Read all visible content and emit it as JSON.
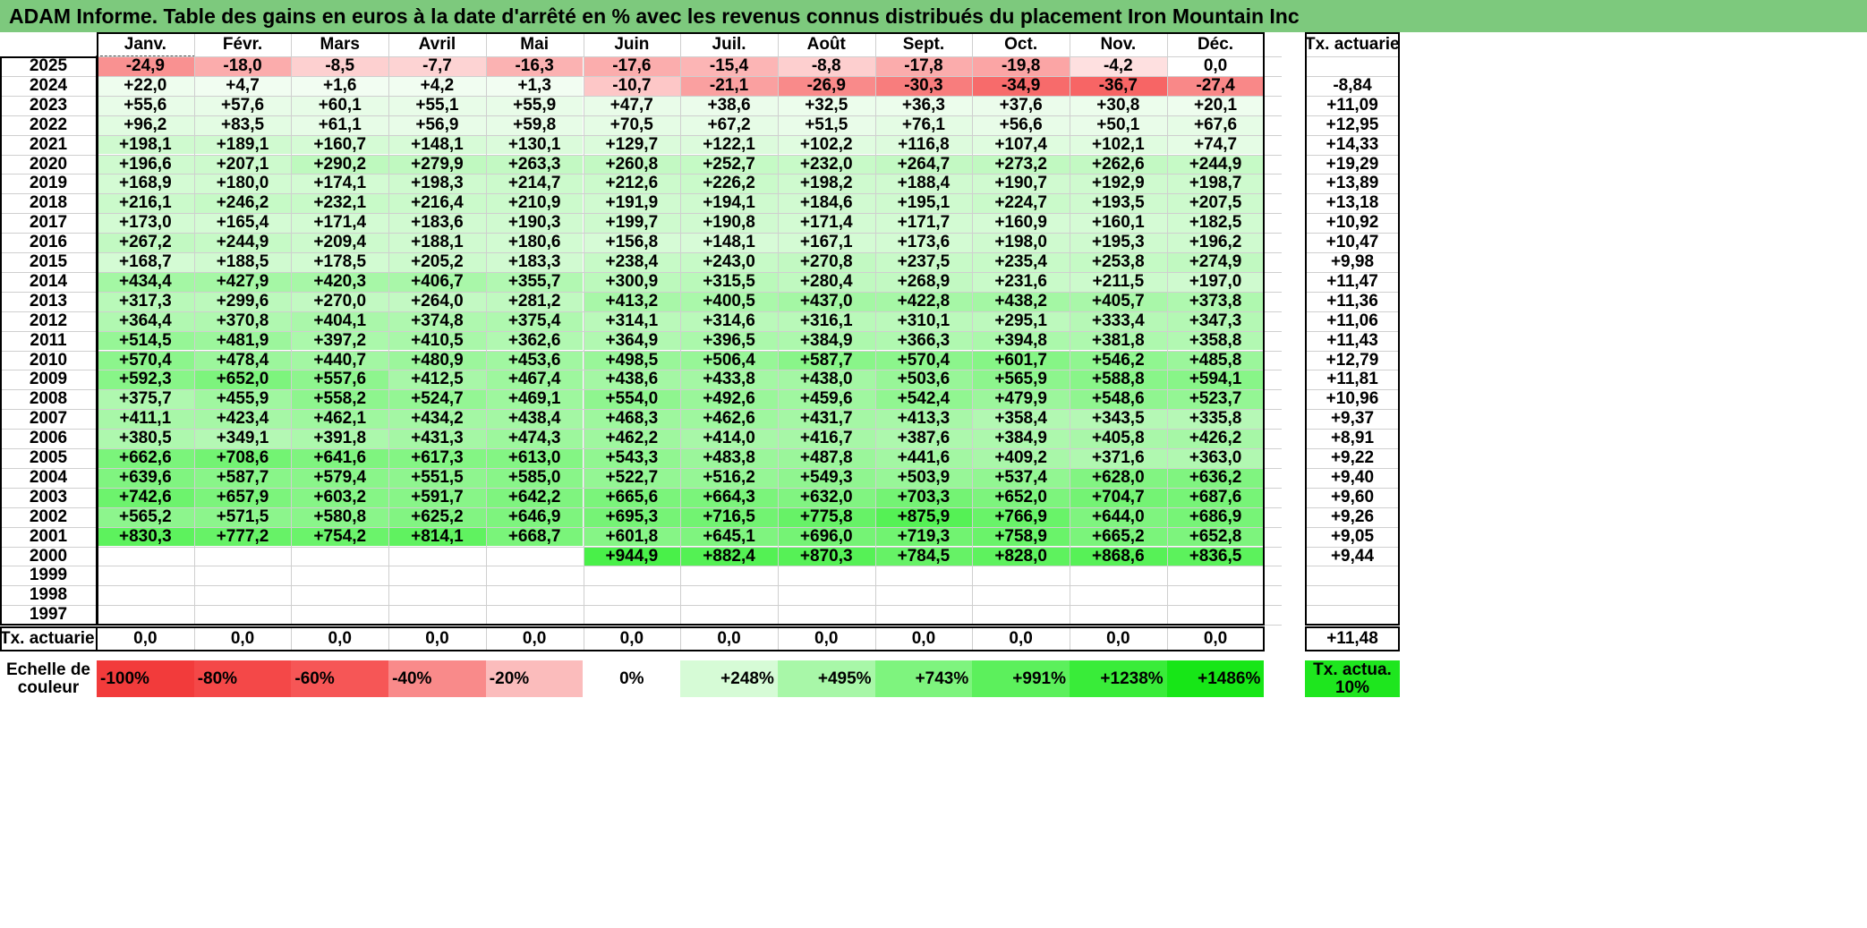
{
  "title": "ADAM Informe. Table des gains en euros à la date d'arrêté en % avec les revenus connus distribués du placement Iron Mountain Inc",
  "chart_data": {
    "type": "heatmap",
    "months": [
      "Janv.",
      "Févr.",
      "Mars",
      "Avril",
      "Mai",
      "Juin",
      "Juil.",
      "Août",
      "Sept.",
      "Oct.",
      "Nov.",
      "Déc."
    ],
    "rate_header": "Tx. actuariel",
    "rows": [
      {
        "year": "2025",
        "values": [
          "-24,9",
          "-18,0",
          "-8,5",
          "-7,7",
          "-16,3",
          "-17,6",
          "-15,4",
          "-8,8",
          "-17,8",
          "-19,8",
          "-4,2",
          "0,0"
        ],
        "rate": ""
      },
      {
        "year": "2024",
        "values": [
          "+22,0",
          "+4,7",
          "+1,6",
          "+4,2",
          "+1,3",
          "-10,7",
          "-21,1",
          "-26,9",
          "-30,3",
          "-34,9",
          "-36,7",
          "-27,4"
        ],
        "rate": "-8,84"
      },
      {
        "year": "2023",
        "values": [
          "+55,6",
          "+57,6",
          "+60,1",
          "+55,1",
          "+55,9",
          "+47,7",
          "+38,6",
          "+32,5",
          "+36,3",
          "+37,6",
          "+30,8",
          "+20,1"
        ],
        "rate": "+11,09"
      },
      {
        "year": "2022",
        "values": [
          "+96,2",
          "+83,5",
          "+61,1",
          "+56,9",
          "+59,8",
          "+70,5",
          "+67,2",
          "+51,5",
          "+76,1",
          "+56,6",
          "+50,1",
          "+67,6"
        ],
        "rate": "+12,95"
      },
      {
        "year": "2021",
        "values": [
          "+198,1",
          "+189,1",
          "+160,7",
          "+148,1",
          "+130,1",
          "+129,7",
          "+122,1",
          "+102,2",
          "+116,8",
          "+107,4",
          "+102,1",
          "+74,7"
        ],
        "rate": "+14,33"
      },
      {
        "year": "2020",
        "values": [
          "+196,6",
          "+207,1",
          "+290,2",
          "+279,9",
          "+263,3",
          "+260,8",
          "+252,7",
          "+232,0",
          "+264,7",
          "+273,2",
          "+262,6",
          "+244,9"
        ],
        "rate": "+19,29"
      },
      {
        "year": "2019",
        "values": [
          "+168,9",
          "+180,0",
          "+174,1",
          "+198,3",
          "+214,7",
          "+212,6",
          "+226,2",
          "+198,2",
          "+188,4",
          "+190,7",
          "+192,9",
          "+198,7"
        ],
        "rate": "+13,89"
      },
      {
        "year": "2018",
        "values": [
          "+216,1",
          "+246,2",
          "+232,1",
          "+216,4",
          "+210,9",
          "+191,9",
          "+194,1",
          "+184,6",
          "+195,1",
          "+224,7",
          "+193,5",
          "+207,5"
        ],
        "rate": "+13,18"
      },
      {
        "year": "2017",
        "values": [
          "+173,0",
          "+165,4",
          "+171,4",
          "+183,6",
          "+190,3",
          "+199,7",
          "+190,8",
          "+171,4",
          "+171,7",
          "+160,9",
          "+160,1",
          "+182,5"
        ],
        "rate": "+10,92"
      },
      {
        "year": "2016",
        "values": [
          "+267,2",
          "+244,9",
          "+209,4",
          "+188,1",
          "+180,6",
          "+156,8",
          "+148,1",
          "+167,1",
          "+173,6",
          "+198,0",
          "+195,3",
          "+196,2"
        ],
        "rate": "+10,47"
      },
      {
        "year": "2015",
        "values": [
          "+168,7",
          "+188,5",
          "+178,5",
          "+205,2",
          "+183,3",
          "+238,4",
          "+243,0",
          "+270,8",
          "+237,5",
          "+235,4",
          "+253,8",
          "+274,9"
        ],
        "rate": "+9,98"
      },
      {
        "year": "2014",
        "values": [
          "+434,4",
          "+427,9",
          "+420,3",
          "+406,7",
          "+355,7",
          "+300,9",
          "+315,5",
          "+280,4",
          "+268,9",
          "+231,6",
          "+211,5",
          "+197,0"
        ],
        "rate": "+11,47"
      },
      {
        "year": "2013",
        "values": [
          "+317,3",
          "+299,6",
          "+270,0",
          "+264,0",
          "+281,2",
          "+413,2",
          "+400,5",
          "+437,0",
          "+422,8",
          "+438,2",
          "+405,7",
          "+373,8"
        ],
        "rate": "+11,36"
      },
      {
        "year": "2012",
        "values": [
          "+364,4",
          "+370,8",
          "+404,1",
          "+374,8",
          "+375,4",
          "+314,1",
          "+314,6",
          "+316,1",
          "+310,1",
          "+295,1",
          "+333,4",
          "+347,3"
        ],
        "rate": "+11,06"
      },
      {
        "year": "2011",
        "values": [
          "+514,5",
          "+481,9",
          "+397,2",
          "+410,5",
          "+362,6",
          "+364,9",
          "+396,5",
          "+384,9",
          "+366,3",
          "+394,8",
          "+381,8",
          "+358,8"
        ],
        "rate": "+11,43"
      },
      {
        "year": "2010",
        "values": [
          "+570,4",
          "+478,4",
          "+440,7",
          "+480,9",
          "+453,6",
          "+498,5",
          "+506,4",
          "+587,7",
          "+570,4",
          "+601,7",
          "+546,2",
          "+485,8"
        ],
        "rate": "+12,79"
      },
      {
        "year": "2009",
        "values": [
          "+592,3",
          "+652,0",
          "+557,6",
          "+412,5",
          "+467,4",
          "+438,6",
          "+433,8",
          "+438,0",
          "+503,6",
          "+565,9",
          "+588,8",
          "+594,1"
        ],
        "rate": "+11,81"
      },
      {
        "year": "2008",
        "values": [
          "+375,7",
          "+455,9",
          "+558,2",
          "+524,7",
          "+469,1",
          "+554,0",
          "+492,6",
          "+459,6",
          "+542,4",
          "+479,9",
          "+548,6",
          "+523,7"
        ],
        "rate": "+10,96"
      },
      {
        "year": "2007",
        "values": [
          "+411,1",
          "+423,4",
          "+462,1",
          "+434,2",
          "+438,4",
          "+468,3",
          "+462,6",
          "+431,7",
          "+413,3",
          "+358,4",
          "+343,5",
          "+335,8"
        ],
        "rate": "+9,37"
      },
      {
        "year": "2006",
        "values": [
          "+380,5",
          "+349,1",
          "+391,8",
          "+431,3",
          "+474,3",
          "+462,2",
          "+414,0",
          "+416,7",
          "+387,6",
          "+384,9",
          "+405,8",
          "+426,2"
        ],
        "rate": "+8,91"
      },
      {
        "year": "2005",
        "values": [
          "+662,6",
          "+708,6",
          "+641,6",
          "+617,3",
          "+613,0",
          "+543,3",
          "+483,8",
          "+487,8",
          "+441,6",
          "+409,2",
          "+371,6",
          "+363,0"
        ],
        "rate": "+9,22"
      },
      {
        "year": "2004",
        "values": [
          "+639,6",
          "+587,7",
          "+579,4",
          "+551,5",
          "+585,0",
          "+522,7",
          "+516,2",
          "+549,3",
          "+503,9",
          "+537,4",
          "+628,0",
          "+636,2"
        ],
        "rate": "+9,40"
      },
      {
        "year": "2003",
        "values": [
          "+742,6",
          "+657,9",
          "+603,2",
          "+591,7",
          "+642,2",
          "+665,6",
          "+664,3",
          "+632,0",
          "+703,3",
          "+652,0",
          "+704,7",
          "+687,6"
        ],
        "rate": "+9,60"
      },
      {
        "year": "2002",
        "values": [
          "+565,2",
          "+571,5",
          "+580,8",
          "+625,2",
          "+646,9",
          "+695,3",
          "+716,5",
          "+775,8",
          "+875,9",
          "+766,9",
          "+644,0",
          "+686,9"
        ],
        "rate": "+9,26"
      },
      {
        "year": "2001",
        "values": [
          "+830,3",
          "+777,2",
          "+754,2",
          "+814,1",
          "+668,7",
          "+601,8",
          "+645,1",
          "+696,0",
          "+719,3",
          "+758,9",
          "+665,2",
          "+652,8"
        ],
        "rate": "+9,05"
      },
      {
        "year": "2000",
        "values": [
          "",
          "",
          "",
          "",
          "",
          "+944,9",
          "+882,4",
          "+870,3",
          "+784,5",
          "+828,0",
          "+868,6",
          "+836,5"
        ],
        "rate": "+9,44"
      },
      {
        "year": "1999",
        "values": [
          "",
          "",
          "",
          "",
          "",
          "",
          "",
          "",
          "",
          "",
          "",
          ""
        ],
        "rate": ""
      },
      {
        "year": "1998",
        "values": [
          "",
          "",
          "",
          "",
          "",
          "",
          "",
          "",
          "",
          "",
          "",
          ""
        ],
        "rate": ""
      },
      {
        "year": "1997",
        "values": [
          "",
          "",
          "",
          "",
          "",
          "",
          "",
          "",
          "",
          "",
          "",
          ""
        ],
        "rate": ""
      }
    ],
    "footer_label": "Tx. actuariel",
    "footer_values": [
      "0,0",
      "0,0",
      "0,0",
      "0,0",
      "0,0",
      "0,0",
      "0,0",
      "0,0",
      "0,0",
      "0,0",
      "0,0",
      "0,0"
    ],
    "footer_rate": "+11,48",
    "scale_label": "Echelle de couleur",
    "scale": [
      {
        "label": "-100%",
        "color": "#f23b3b",
        "align": "left"
      },
      {
        "label": "-80%",
        "color": "#f44848",
        "align": "left"
      },
      {
        "label": "-60%",
        "color": "#f65656",
        "align": "left"
      },
      {
        "label": "-40%",
        "color": "#f98a8a",
        "align": "left"
      },
      {
        "label": "-20%",
        "color": "#fbbcbc",
        "align": "left"
      },
      {
        "label": "0%",
        "color": "#ffffff",
        "align": "center"
      },
      {
        "label": "+248%",
        "color": "#d6fbd6",
        "align": "right"
      },
      {
        "label": "+495%",
        "color": "#a8f7a8",
        "align": "right"
      },
      {
        "label": "+743%",
        "color": "#7ef47e",
        "align": "right"
      },
      {
        "label": "+991%",
        "color": "#5cf05c",
        "align": "right"
      },
      {
        "label": "+1238%",
        "color": "#39ec39",
        "align": "right"
      },
      {
        "label": "+1486%",
        "color": "#17e617",
        "align": "right"
      }
    ],
    "scale_rate_label": "Tx. actua. 10%",
    "scale_rate_color": "#1ee61e",
    "neg_min": -100,
    "pos_max": 1486
  }
}
